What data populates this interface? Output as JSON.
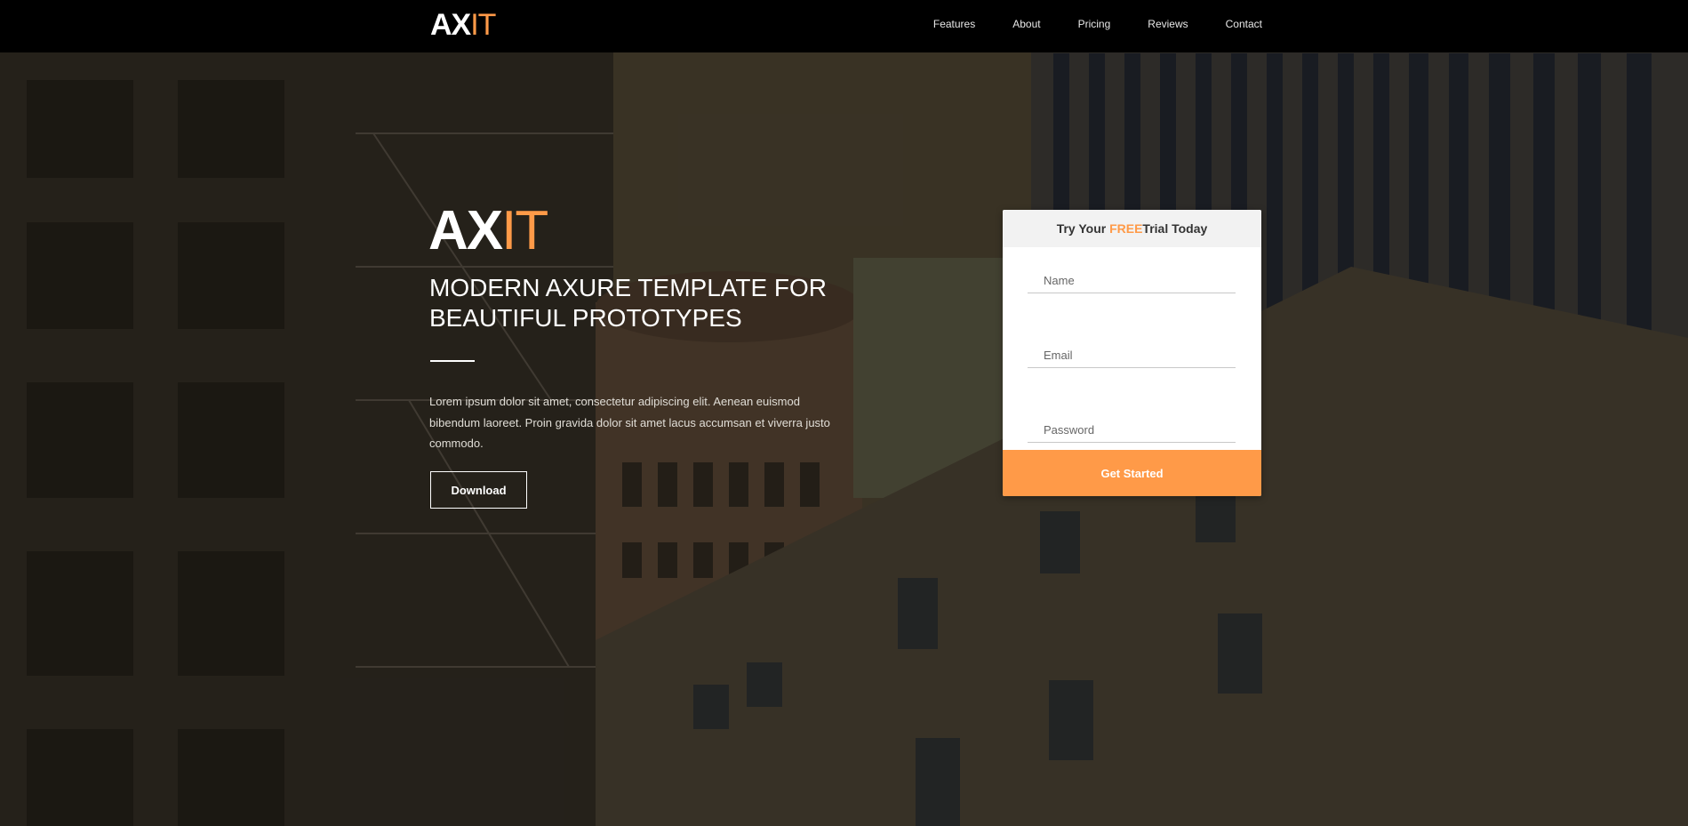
{
  "brand": {
    "part1": "AX",
    "part2": "IT"
  },
  "nav": {
    "items": [
      {
        "label": "Features"
      },
      {
        "label": "About"
      },
      {
        "label": "Pricing"
      },
      {
        "label": "Reviews"
      },
      {
        "label": "Contact"
      }
    ]
  },
  "hero": {
    "logo_part1": "AX",
    "logo_part2": "IT",
    "title_line1": "MODERN AXURE TEMPLATE FOR",
    "title_line2": "BEAUTIFUL PROTOTYPES",
    "description": "Lorem ipsum dolor sit amet, consectetur adipiscing elit. Aenean euismod bibendum laoreet. Proin gravida dolor sit amet lacus accumsan et viverra justo commodo.",
    "download_label": "Download"
  },
  "signup": {
    "header_prefix": "Try Your ",
    "header_highlight": "FREE",
    "header_suffix": "Trial Today",
    "name_placeholder": "Name",
    "email_placeholder": "Email",
    "password_placeholder": "Password",
    "submit_label": "Get Started"
  },
  "colors": {
    "accent": "#ff9a48",
    "navbar_bg": "#000000",
    "text_light": "#ffffff"
  }
}
